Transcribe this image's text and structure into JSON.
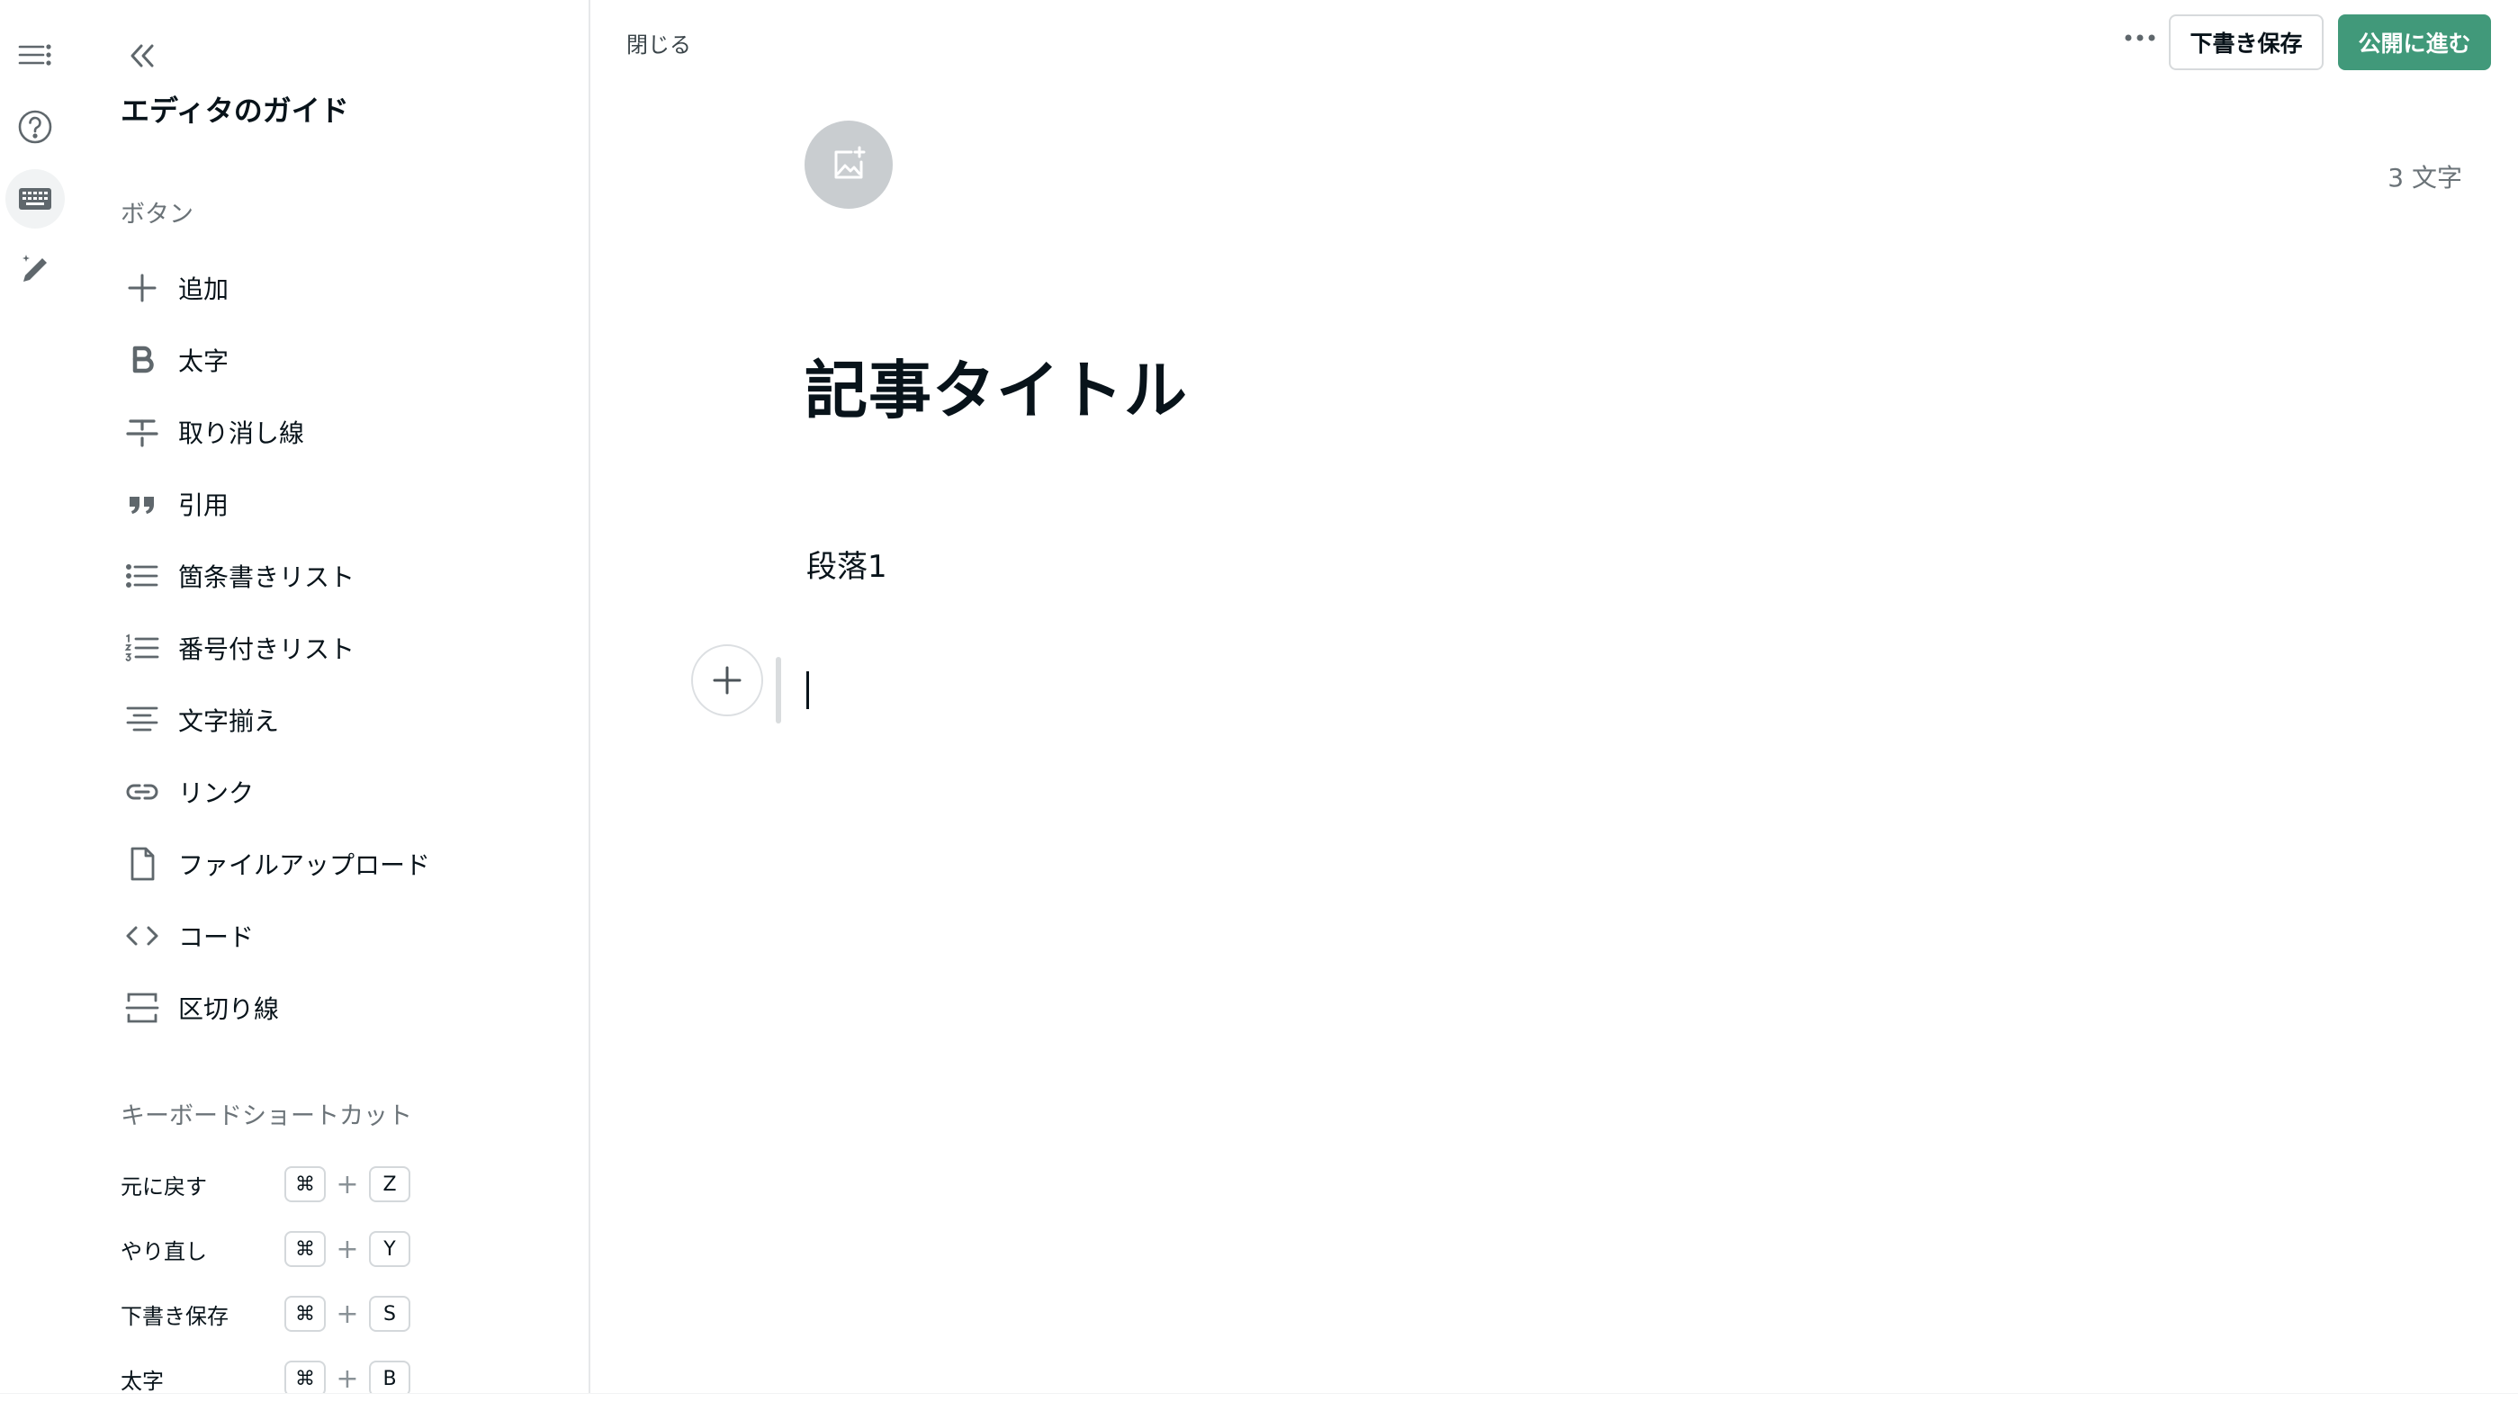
{
  "rail": {
    "items": [
      {
        "name": "menu"
      },
      {
        "name": "help"
      },
      {
        "name": "keyboard"
      },
      {
        "name": "magic-pen"
      }
    ]
  },
  "guide": {
    "title": "エディタのガイド",
    "buttons_heading": "ボタン",
    "buttons": [
      {
        "icon": "plus-icon",
        "label": "追加"
      },
      {
        "icon": "bold-icon",
        "label": "太字"
      },
      {
        "icon": "strikethrough-icon",
        "label": "取り消し線"
      },
      {
        "icon": "quote-icon",
        "label": "引用"
      },
      {
        "icon": "bullet-list-icon",
        "label": "箇条書きリスト"
      },
      {
        "icon": "numbered-list-icon",
        "label": "番号付きリスト"
      },
      {
        "icon": "align-center-icon",
        "label": "文字揃え"
      },
      {
        "icon": "link-icon",
        "label": "リンク"
      },
      {
        "icon": "file-icon",
        "label": "ファイルアップロード"
      },
      {
        "icon": "code-icon",
        "label": "コード"
      },
      {
        "icon": "divider-icon",
        "label": "区切り線"
      }
    ],
    "shortcuts_heading": "キーボードショートカット",
    "shortcuts": [
      {
        "label": "元に戻す",
        "mod": "⌘",
        "plus": "+",
        "key": "Z"
      },
      {
        "label": "やり直し",
        "mod": "⌘",
        "plus": "+",
        "key": "Y"
      },
      {
        "label": "下書き保存",
        "mod": "⌘",
        "plus": "+",
        "key": "S"
      },
      {
        "label": "太字",
        "mod": "⌘",
        "plus": "+",
        "key": "B"
      }
    ]
  },
  "topbar": {
    "close_label": "閉じる",
    "draft_label": "下書き保存",
    "publish_label": "公開に進む"
  },
  "editor": {
    "char_count": "3 文字",
    "title": "記事タイトル",
    "paragraph": "段落1"
  },
  "colors": {
    "accent": "#41997a",
    "text": "#08131a",
    "muted": "#6b7378"
  }
}
